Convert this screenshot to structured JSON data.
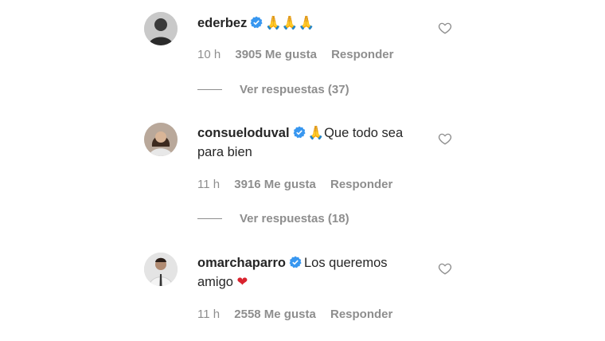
{
  "comments": [
    {
      "username": "ederbez",
      "text": "",
      "emoji": "🙏🙏🙏",
      "time": "10 h",
      "likes": "3905 Me gusta",
      "reply": "Responder",
      "view_replies": "Ver respuestas (37)"
    },
    {
      "username": "consueloduval",
      "emoji": "🙏",
      "text": "Que todo sea para bien",
      "time": "11 h",
      "likes": "3916 Me gusta",
      "reply": "Responder",
      "view_replies": "Ver respuestas (18)"
    },
    {
      "username": "omarchaparro",
      "text": "Los queremos amigo",
      "heart": "❤",
      "time": "11 h",
      "likes": "2558 Me gusta",
      "reply": "Responder"
    }
  ],
  "colors": {
    "text": "#262626",
    "meta": "#8e8e8e",
    "verified": "#3897f0",
    "heart_emoji": "#d9232e"
  }
}
